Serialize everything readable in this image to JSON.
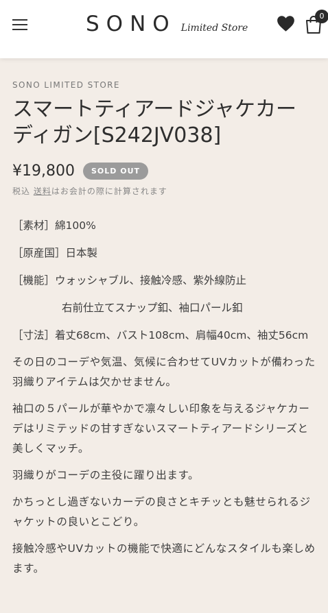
{
  "header": {
    "logo_main": "SONO",
    "logo_sub": "Limited Store",
    "cart_count": "0"
  },
  "product": {
    "vendor": "SONO LIMITED STORE",
    "title": "スマートティアードジャケカーディガン[S242JV038]",
    "price": "¥19,800",
    "badge": "SOLD OUT",
    "tax_prefix": "税込 ",
    "tax_link": "送料",
    "tax_suffix": "はお会計の際に計算されます"
  },
  "description": {
    "specs": [
      "［素材］綿100%",
      "［原産国］日本製",
      "［機能］ウォッシャブル、接触冷感、紫外線防止",
      "右前仕立てスナップ釦、袖口パール釦",
      "［寸法］着丈68cm、バスト108cm、肩幅40cm、袖丈56cm"
    ],
    "paragraphs": [
      "その日のコーデや気温、気候に合わせてUVカットが備わった羽織りアイテムは欠かせません。",
      "袖口の５パールが華やかで凛々しい印象を与えるジャケカーデはリミテッドの甘すぎないスマートティアードシリーズと美しくマッチ。",
      "羽織りがコーデの主役に躍り出ます。",
      "かちっとし過ぎないカーデの良さとキチッとも魅せられるジャケットの良いとこどり。",
      "接触冷感やUVカットの機能で快適にどんなスタイルも楽しめます。"
    ]
  },
  "icons": [
    "menu-icon",
    "heart-icon",
    "cart-icon"
  ],
  "colors": {
    "background": "#f3ede7",
    "header": "#ffffff",
    "badge": "#9b9b9b",
    "text": "#3a3a3a"
  }
}
